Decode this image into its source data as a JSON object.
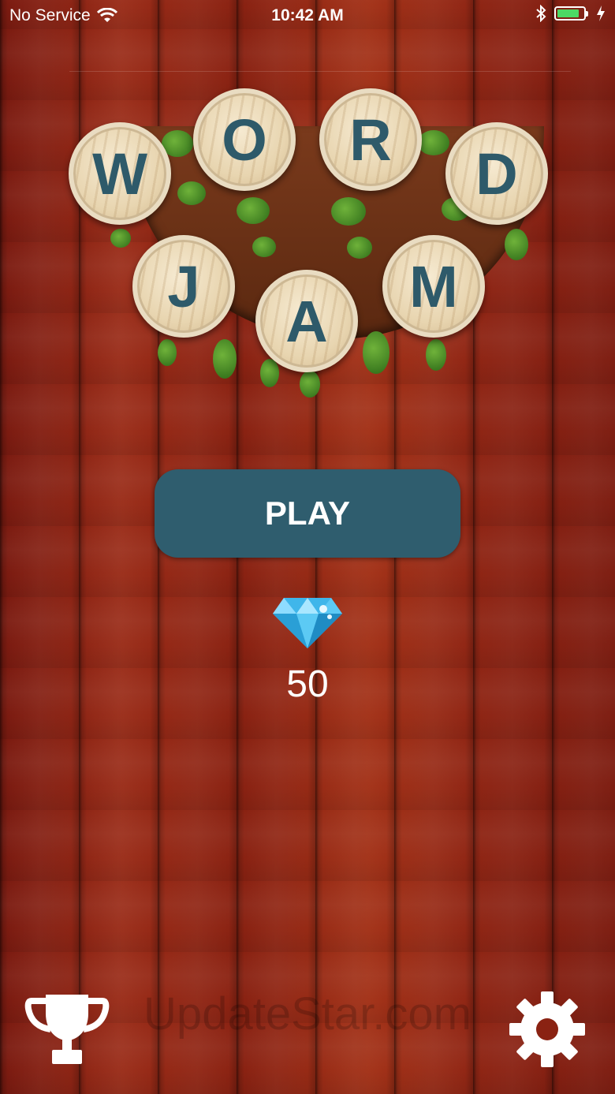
{
  "status_bar": {
    "carrier": "No Service",
    "time": "10:42 AM",
    "battery_level": 0.85,
    "icons": [
      "wifi-icon",
      "bluetooth-icon",
      "battery-icon",
      "charging-icon"
    ]
  },
  "logo": {
    "letters": [
      "W",
      "O",
      "R",
      "D",
      "J",
      "A",
      "M"
    ]
  },
  "play_button": {
    "label": "PLAY"
  },
  "currency": {
    "icon": "diamond-icon",
    "count": "50"
  },
  "watermark": "UpdateStar.com",
  "bottom_bar": {
    "left_icon": "trophy-icon",
    "right_icon": "gear-icon"
  },
  "colors": {
    "accent": "#2f5d6e",
    "letter": "#2e5a6a",
    "battery": "#4cd964"
  }
}
